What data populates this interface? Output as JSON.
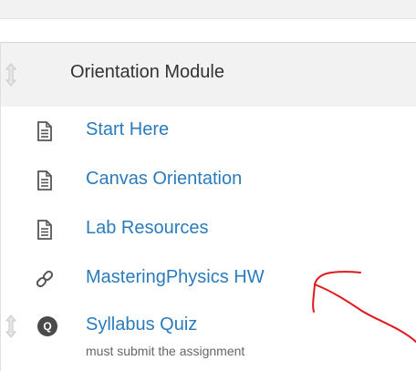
{
  "module": {
    "title": "Orientation Module",
    "items": [
      {
        "label": "Start Here",
        "icon": "document-icon"
      },
      {
        "label": "Canvas Orientation",
        "icon": "document-icon"
      },
      {
        "label": "Lab Resources",
        "icon": "document-icon"
      },
      {
        "label": "MasteringPhysics HW",
        "icon": "link-icon"
      },
      {
        "label": "Syllabus Quiz",
        "icon": "quiz-icon",
        "badge": "Q",
        "requirement": "must submit the assignment"
      }
    ]
  },
  "colors": {
    "link": "#2a7bbd",
    "header_bg": "#f2f2f2",
    "annotation": "#e0191f"
  }
}
